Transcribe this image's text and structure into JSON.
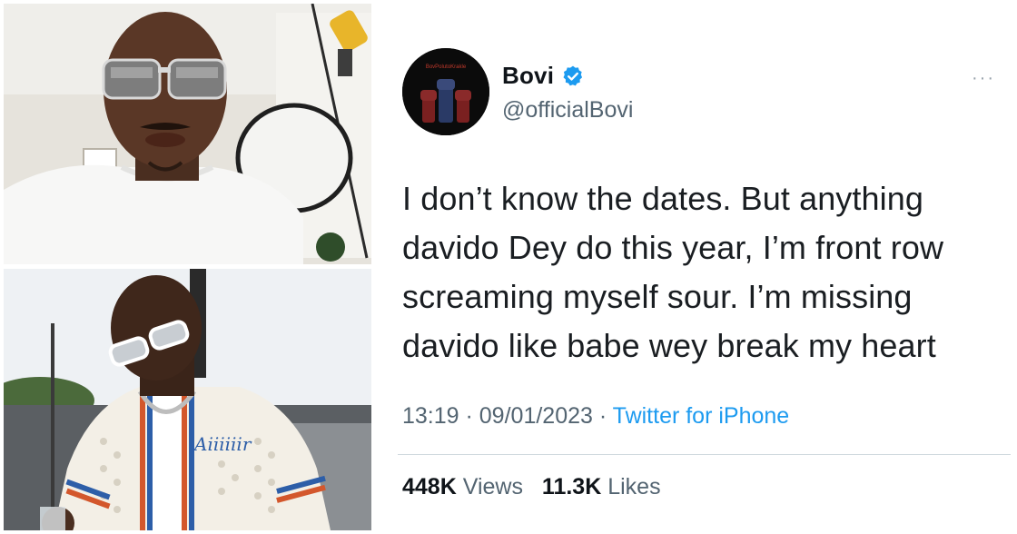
{
  "tweet": {
    "display_name": "Bovi",
    "handle": "@officialBovi",
    "verified": true,
    "avatar_text": "BovPolutoKrakle",
    "text_lines": [
      "I don’t know the dates. But anything",
      "davido Dey do this year, I’m front row",
      "screaming myself sour. I’m missing",
      "davido like babe wey break my heart"
    ],
    "time": "13:19",
    "date": "09/01/2023",
    "separator": " · ",
    "source": "Twitter for iPhone",
    "more_icon": "···",
    "stats": {
      "views_count": "448K",
      "views_label": "Views",
      "likes_count": "11.3K",
      "likes_label": "Likes"
    }
  },
  "photos": {
    "bottom_shirt_text": "Aiiiiiir"
  },
  "colors": {
    "twitter_blue": "#1d9bf0",
    "text_primary": "#0f1419",
    "text_secondary": "#536471"
  },
  "icons": {
    "verified": "verified-badge-icon",
    "more": "more-options-icon"
  }
}
